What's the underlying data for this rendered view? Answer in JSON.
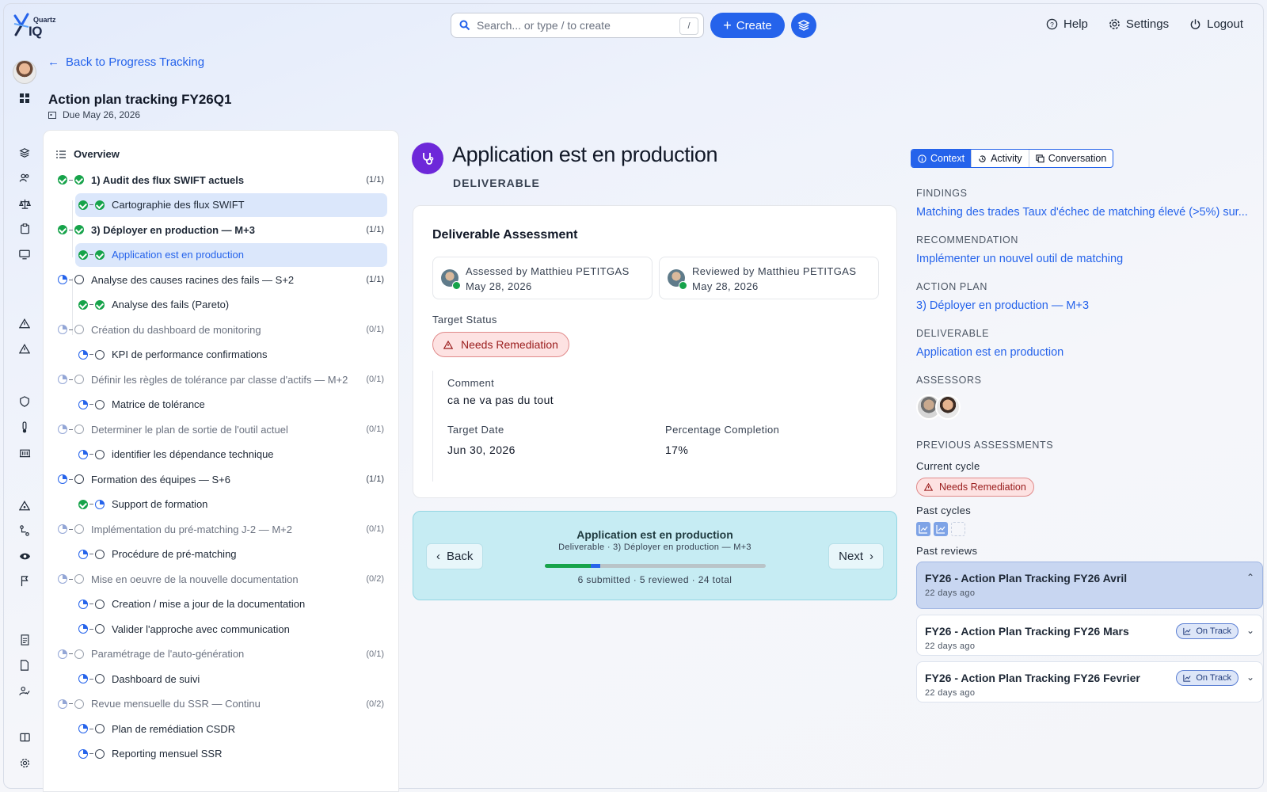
{
  "brand": {
    "name_top": "Quartz",
    "name_main": "IQ"
  },
  "search": {
    "placeholder": "Search... or type / to create",
    "shortcut": "/"
  },
  "topbar": {
    "create_label": "Create",
    "help_label": "Help",
    "settings_label": "Settings",
    "logout_label": "Logout"
  },
  "header": {
    "back_label": "Back to Progress Tracking",
    "title": "Action plan tracking FY26Q1",
    "due": "Due May 26, 2026"
  },
  "tree": {
    "overview_label": "Overview",
    "items": [
      {
        "label": "1) Audit des flux SWIFT actuels",
        "count": "(1/1)"
      },
      {
        "label": "Cartographie des flux SWIFT"
      },
      {
        "label": "3) Déployer en production — M+3",
        "count": "(1/1)"
      },
      {
        "label": "Application est en production"
      },
      {
        "label": "Analyse des causes racines des fails — S+2",
        "count": "(1/1)"
      },
      {
        "label": "Analyse des fails (Pareto)"
      },
      {
        "label": "Création du dashboard de monitoring",
        "count": "(0/1)"
      },
      {
        "label": "KPI de performance confirmations"
      },
      {
        "label": "Définir les règles de tolérance par classe d'actifs — M+2",
        "count": "(0/1)"
      },
      {
        "label": "Matrice de tolérance"
      },
      {
        "label": "Determiner le plan de sortie de l'outil actuel",
        "count": "(0/1)"
      },
      {
        "label": "identifier les dépendance technique"
      },
      {
        "label": "Formation des équipes — S+6",
        "count": "(1/1)"
      },
      {
        "label": "Support de formation"
      },
      {
        "label": "Implémentation du pré-matching J-2 — M+2",
        "count": "(0/1)"
      },
      {
        "label": "Procédure de pré-matching"
      },
      {
        "label": "Mise en oeuvre de la nouvelle documentation",
        "count": "(0/2)"
      },
      {
        "label": "Creation / mise a jour de la documentation"
      },
      {
        "label": "Valider l'approche avec communication"
      },
      {
        "label": "Paramétrage de l'auto-génération",
        "count": "(0/1)"
      },
      {
        "label": "Dashboard de suivi"
      },
      {
        "label": "Revue mensuelle du SSR — Continu",
        "count": "(0/2)"
      },
      {
        "label": "Plan de remédiation CSDR"
      },
      {
        "label": "Reporting mensuel SSR"
      }
    ]
  },
  "main": {
    "title": "Application est en production",
    "type": "DELIVERABLE",
    "card_title": "Deliverable Assessment",
    "assessed_by": "Assessed by Matthieu PETITGAS",
    "assessed_date": "May 28, 2026",
    "reviewed_by": "Reviewed by Matthieu PETITGAS",
    "reviewed_date": "May 28, 2026",
    "target_status_label": "Target Status",
    "target_status": "Needs Remediation",
    "comment_label": "Comment",
    "comment": "ca ne va pas du tout",
    "target_date_label": "Target Date",
    "target_date": "Jun 30, 2026",
    "pct_label": "Percentage Completion",
    "pct": "17%"
  },
  "nav": {
    "back_label": "Back",
    "next_label": "Next",
    "title": "Application est en production",
    "subtitle": "Deliverable · 3) Déployer en production — M+3",
    "stats": "6 submitted · 5 reviewed · 24 total",
    "submitted": 6,
    "reviewed": 5,
    "total": 24
  },
  "side": {
    "tabs": [
      "Context",
      "Activity",
      "Conversation"
    ],
    "findings_label": "FINDINGS",
    "findings": "Matching des trades Taux d'échec de matching élevé (>5%) sur...",
    "recommendation_label": "RECOMMENDATION",
    "recommendation": "Implémenter un nouvel outil de matching",
    "action_plan_label": "ACTION PLAN",
    "action_plan": "3) Déployer en production — M+3",
    "deliverable_label": "DELIVERABLE",
    "deliverable": "Application est en production",
    "assessors_label": "ASSESSORS",
    "prev_label": "PREVIOUS ASSESSMENTS",
    "current_cycle_label": "Current cycle",
    "current_cycle_status": "Needs Remediation",
    "past_cycles_label": "Past cycles",
    "past_reviews_label": "Past reviews",
    "reviews": [
      {
        "title": "FY26 - Action Plan Tracking FY26 Avril",
        "ago": "22 days ago"
      },
      {
        "title": "FY26 - Action Plan Tracking FY26 Mars",
        "ago": "22 days ago",
        "status": "On Track"
      },
      {
        "title": "FY26 - Action Plan Tracking FY26 Fevrier",
        "ago": "22 days ago",
        "status": "On Track"
      }
    ]
  },
  "colors": {
    "accent": "#2563eb",
    "deliverable_icon": "#6d28d9",
    "done": "#16a34a",
    "remediation": "#991b1b"
  }
}
